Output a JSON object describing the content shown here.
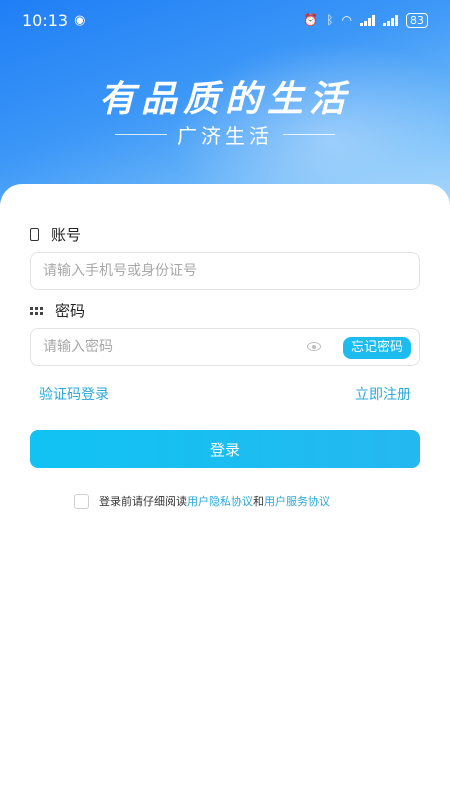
{
  "status": {
    "time": "10:13",
    "battery": "83"
  },
  "hero": {
    "slogan": "有品质的生活",
    "app_name": "广济生活"
  },
  "account": {
    "label": "账号",
    "placeholder": "请输入手机号或身份证号"
  },
  "password": {
    "label": "密码",
    "placeholder": "请输入密码",
    "forgot": "忘记密码"
  },
  "links": {
    "sms_login": "验证码登录",
    "register": "立即注册"
  },
  "login": {
    "label": "登录"
  },
  "agreement": {
    "prefix": "登录前请仔细阅读",
    "privacy": "用户隐私协议",
    "and": "和",
    "service": "用户服务协议"
  }
}
